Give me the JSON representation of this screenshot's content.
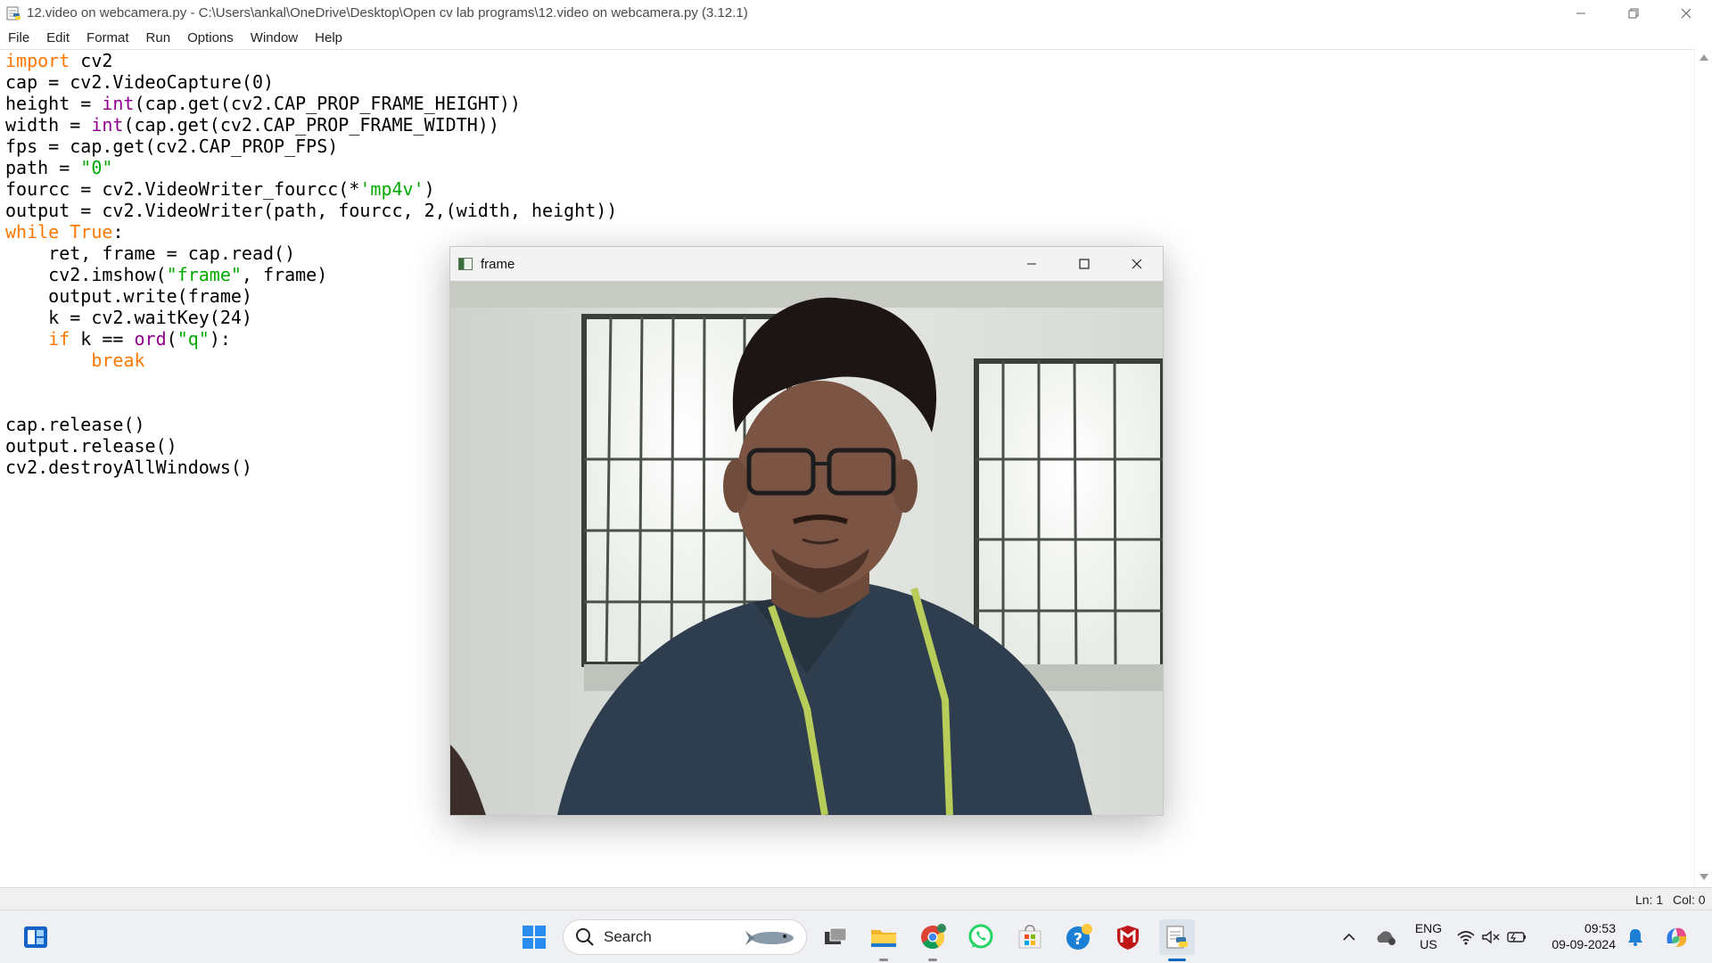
{
  "window": {
    "title": "12.video on webcamera.py - C:\\Users\\ankal\\OneDrive\\Desktop\\Open cv lab programs\\12.video on webcamera.py (3.12.1)",
    "icon": "python-idle-icon"
  },
  "menu": [
    "File",
    "Edit",
    "Format",
    "Run",
    "Options",
    "Window",
    "Help"
  ],
  "code": {
    "l1_kw": "import",
    "l1_rest": " cv2",
    "l2": "cap = cv2.VideoCapture(0)",
    "l3_a": "height = ",
    "l3_bi": "int",
    "l3_b": "(cap.get(cv2.CAP_PROP_FRAME_HEIGHT))",
    "l4_a": "width = ",
    "l4_bi": "int",
    "l4_b": "(cap.get(cv2.CAP_PROP_FRAME_WIDTH))",
    "l5": "fps = cap.get(cv2.CAP_PROP_FPS)",
    "l6_a": "path = ",
    "l6_st": "\"0\"",
    "l7_a": "fourcc = cv2.VideoWriter_fourcc(*",
    "l7_st": "'mp4v'",
    "l7_b": ")",
    "l8": "output = cv2.VideoWriter(path, fourcc, 2,(width, height))",
    "l9_kw1": "while",
    "l9_sp": " ",
    "l9_kw2": "True",
    "l9_b": ":",
    "l10": "    ret, frame = cap.read()",
    "l11_a": "    cv2.imshow(",
    "l11_st": "\"frame\"",
    "l11_b": ", frame)",
    "l12": "    output.write(frame)",
    "l13": "    k = cv2.waitKey(24)",
    "l14_ind": "    ",
    "l14_kw": "if",
    "l14_a": " k == ",
    "l14_bi": "ord",
    "l14_b": "(",
    "l14_st": "\"q\"",
    "l14_c": "):",
    "l15_ind": "        ",
    "l15_kw": "break",
    "l18": "cap.release()",
    "l19": "output.release()",
    "l20": "cv2.destroyAllWindows()"
  },
  "status": {
    "ln": "Ln: 1",
    "col": "Col: 0"
  },
  "frame_window": {
    "title": "frame"
  },
  "taskbar": {
    "search_label": "Search",
    "lang_top": "ENG",
    "lang_bottom": "US",
    "time": "09:53",
    "date": "09-09-2024"
  },
  "colors": {
    "keyword": "#ff7700",
    "builtin": "#900090",
    "string": "#00aa00",
    "accent": "#0067c0"
  }
}
